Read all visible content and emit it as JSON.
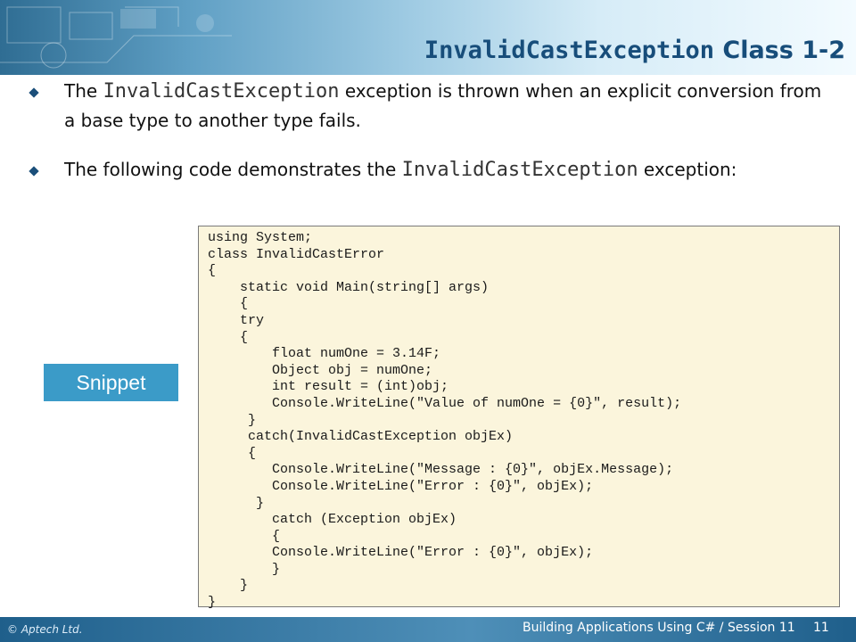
{
  "slide": {
    "title_code": "InvalidCastException",
    "title_suffix": " Class 1-2"
  },
  "bullets": [
    {
      "text_before": "The ",
      "code": "InvalidCastException",
      "text_after": " exception is thrown when an explicit conversion from a base type to another type fails."
    },
    {
      "text_before": "The following code demonstrates the ",
      "code": "InvalidCastException",
      "text_after": " exception:"
    }
  ],
  "snippet_label": "Snippet",
  "code": "using System;\nclass InvalidCastError\n{\n    static void Main(string[] args)\n    {\n    try\n    {\n        float numOne = 3.14F;\n        Object obj = numOne;\n        int result = (int)obj;\n        Console.WriteLine(\"Value of numOne = {0}\", result);\n     }\n     catch(InvalidCastException objEx)\n     {\n        Console.WriteLine(\"Message : {0}\", objEx.Message);\n        Console.WriteLine(\"Error : {0}\", objEx);\n      }\n        catch (Exception objEx)\n        {\n        Console.WriteLine(\"Error : {0}\", objEx);\n        }\n    }\n}",
  "footer": {
    "copyright": "© Aptech Ltd.",
    "course": "Building Applications Using C# / Session 11",
    "page": "11"
  }
}
